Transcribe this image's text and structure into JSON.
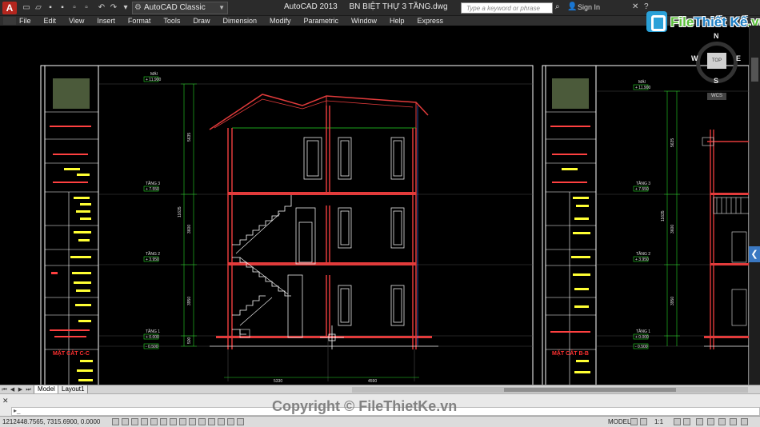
{
  "titlebar": {
    "app_name": "AutoCAD 2013",
    "file_name": "BN BIỆT THỰ 3 TẦNG.dwg",
    "workspace": "AutoCAD Classic",
    "search_placeholder": "Type a keyword or phrase",
    "sign_in": "Sign In"
  },
  "menubar": {
    "items": [
      "File",
      "Edit",
      "View",
      "Insert",
      "Format",
      "Tools",
      "Draw",
      "Dimension",
      "Modify",
      "Parametric",
      "Window",
      "Help",
      "Express"
    ]
  },
  "brand": {
    "part1": "File",
    "part2": "Thiết Kế",
    "part3": ".vn"
  },
  "viewcube": {
    "north": "N",
    "south": "S",
    "east": "E",
    "west": "W",
    "top": "TOP",
    "wcs": "WCS"
  },
  "sheets": [
    {
      "title": "MẶT CẮT C-C",
      "levels": [
        {
          "name": "MÁI",
          "value": "+ 11.900"
        },
        {
          "name": "TẦNG 3",
          "value": "+ 7.550"
        },
        {
          "name": "TẦNG 2",
          "value": "+ 3.950"
        },
        {
          "name": "TẦNG 1",
          "value": "+ 0.000"
        },
        {
          "name": "",
          "value": "- 0.500"
        }
      ],
      "dims_vertical": [
        "5635",
        "11635",
        "3600",
        "3950",
        "500"
      ],
      "dims_horizontal": [
        "5330",
        "4590"
      ]
    },
    {
      "title": "MẶT CẮT B-B",
      "levels": [
        {
          "name": "MÁI",
          "value": "+ 11.900"
        },
        {
          "name": "TẦNG 3",
          "value": "+ 7.550"
        },
        {
          "name": "TẦNG 2",
          "value": "+ 3.950"
        },
        {
          "name": "TẦNG 1",
          "value": "+ 0.000"
        },
        {
          "name": "",
          "value": "- 0.500"
        }
      ],
      "dims_vertical": [
        "5635",
        "11635",
        "3600",
        "3950",
        "500"
      ]
    }
  ],
  "tabs": [
    "Model",
    "Layout1"
  ],
  "cmdline": {
    "watermark": "Copyright © FileThietKe.vn"
  },
  "statusbar": {
    "coords": "1212448.7565, 7315.6900, 0.0000",
    "model": "MODEL",
    "scale": "1:1"
  },
  "colors": {
    "frame": "#ffffff",
    "wall": "#e23b3b",
    "window": "#e8e8e8",
    "stair": "#ffffff",
    "dim": "#26d826",
    "grid": "#5a5a5a",
    "label": "#ffff33",
    "level_box": "#26d826"
  }
}
